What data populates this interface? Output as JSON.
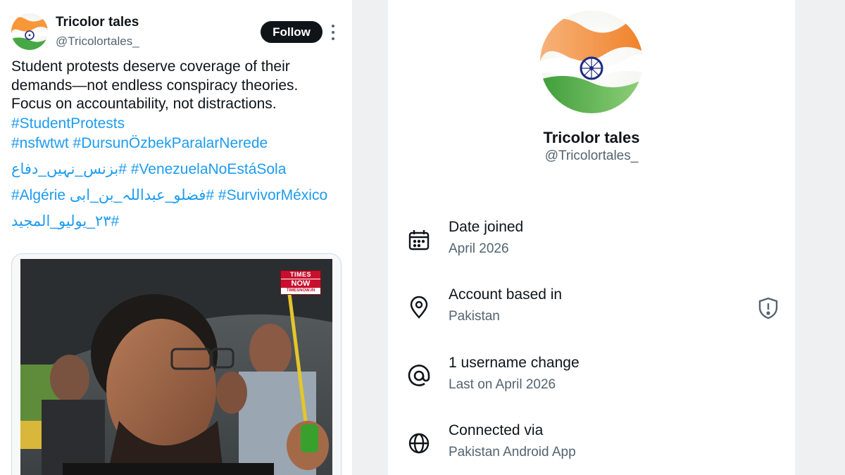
{
  "tweet": {
    "author": {
      "name": "Tricolor tales",
      "handle": "@Tricolortales_"
    },
    "follow_label": "Follow",
    "text_lines": [
      "Student protests deserve coverage of their",
      "demands—not endless conspiracy theories.",
      "Focus on accountability, not distractions."
    ],
    "hashtags": {
      "studentprotests": "#StudentProtests",
      "nsfwtwt": "#nsfwtwt",
      "dursun": "#DursunÖzbekParalarNerede",
      "business": "#بزنس_نہیں_دفاع",
      "venezuela": "#VenezuelaNoEstáSola",
      "algerie": "#Algérie",
      "fazlu": "#فضلو_عبداللہ_بن_ابی",
      "survivor": "#SurvivorMéxico",
      "july": "#٢٣_يوليو_المجيد"
    },
    "media": {
      "logo_top": "TIMES",
      "logo_mid": "NOW",
      "logo_bottom": "TIMESNOW.IN"
    }
  },
  "about": {
    "name": "Tricolor tales",
    "handle": "@Tricolortales_",
    "rows": [
      {
        "icon": "calendar-icon",
        "label": "Date joined",
        "value": "April 2026"
      },
      {
        "icon": "location-pin-icon",
        "label": "Account based in",
        "value": "Pakistan"
      },
      {
        "icon": "at-sign-icon",
        "label": "1 username change",
        "value": "Last on April 2026"
      },
      {
        "icon": "globe-icon",
        "label": "Connected via",
        "value": "Pakistan Android App"
      }
    ]
  },
  "colors": {
    "link": "#1d9bf0",
    "text_primary": "#0f1419",
    "text_secondary": "#536471",
    "follow_bg": "#0f1419",
    "saffron": "#ff9933",
    "green": "#138808",
    "chakra": "#000080"
  }
}
